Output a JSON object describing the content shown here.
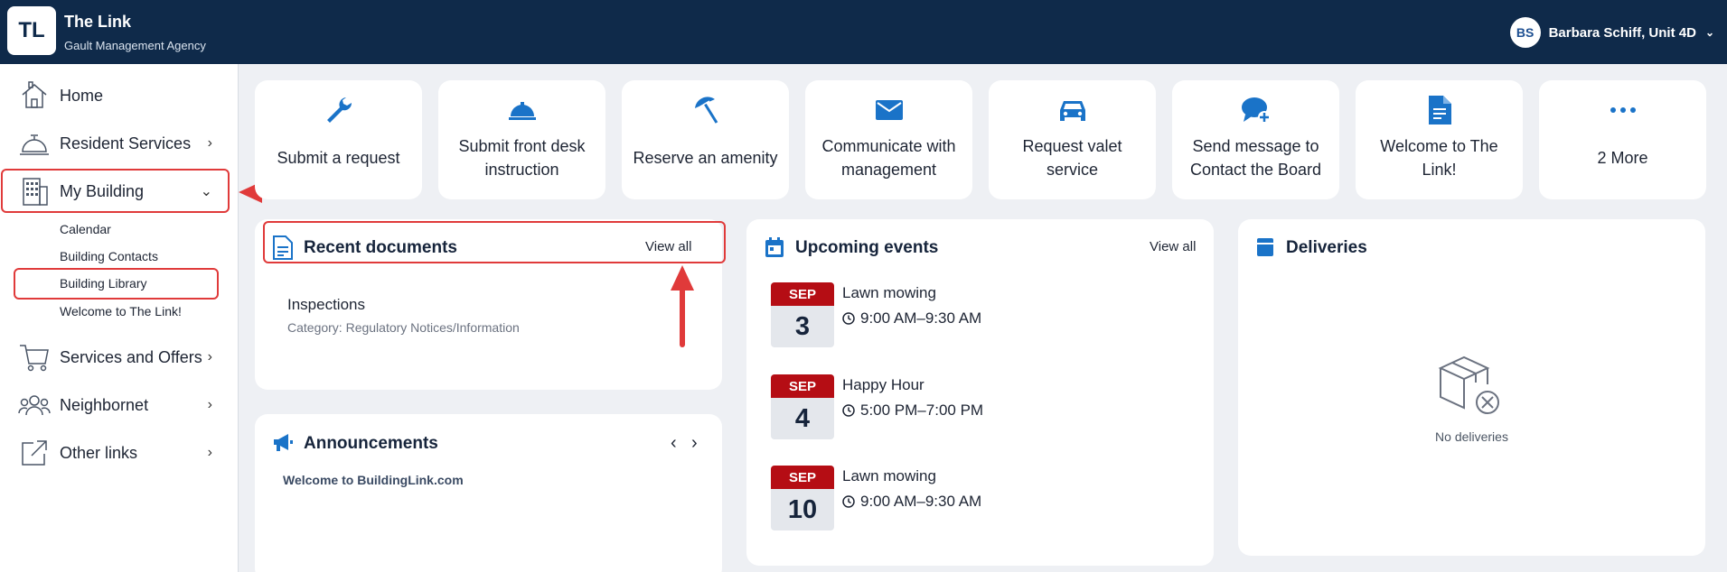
{
  "header": {
    "logo_text": "TL",
    "app_title": "The Link",
    "app_subtitle": "Gault Management Agency",
    "user_initials": "BS",
    "user_name": "Barbara Schiff, Unit 4D",
    "bg_color": "#0f2a4a"
  },
  "sidebar": {
    "items": [
      {
        "label": "Home",
        "icon": "home-icon",
        "expandable": false
      },
      {
        "label": "Resident Services",
        "icon": "service-bell-icon",
        "expandable": true
      },
      {
        "label": "My Building",
        "icon": "building-icon",
        "expandable": true,
        "expanded": true
      },
      {
        "label": "Services and Offers",
        "icon": "cart-icon",
        "expandable": true
      },
      {
        "label": "Neighbornet",
        "icon": "people-icon",
        "expandable": true
      },
      {
        "label": "Other links",
        "icon": "external-link-icon",
        "expandable": true
      }
    ],
    "subitems": [
      "Calendar",
      "Building Contacts",
      "Building Library",
      "Welcome to The Link!"
    ]
  },
  "quick_actions": [
    {
      "label": "Submit a request",
      "icon": "wrench-icon"
    },
    {
      "label": "Submit front desk instruction",
      "icon": "service-bell-icon"
    },
    {
      "label": "Reserve an amenity",
      "icon": "umbrella-icon"
    },
    {
      "label": "Communicate with management",
      "icon": "envelope-icon"
    },
    {
      "label": "Request valet service",
      "icon": "car-icon"
    },
    {
      "label": "Send message to Contact the Board",
      "icon": "chat-plus-icon"
    },
    {
      "label": "Welcome to The Link!",
      "icon": "document-icon"
    },
    {
      "label": "2 More",
      "icon": "more-dots-icon"
    }
  ],
  "recent_documents": {
    "title": "Recent documents",
    "view_all": "View all",
    "items": [
      {
        "title": "Inspections",
        "category": "Category: Regulatory Notices/Information"
      }
    ]
  },
  "announcements": {
    "title": "Announcements",
    "items": [
      "Welcome to BuildingLink.com"
    ]
  },
  "upcoming_events": {
    "title": "Upcoming events",
    "view_all": "View all",
    "items": [
      {
        "month": "SEP",
        "day": "3",
        "title": "Lawn mowing",
        "time": "9:00 AM–9:30 AM"
      },
      {
        "month": "SEP",
        "day": "4",
        "title": "Happy Hour",
        "time": "5:00 PM–7:00 PM"
      },
      {
        "month": "SEP",
        "day": "10",
        "title": "Lawn mowing",
        "time": "9:00 AM–9:30 AM"
      }
    ]
  },
  "deliveries": {
    "title": "Deliveries",
    "empty_text": "No deliveries"
  },
  "colors": {
    "accent": "#1a73c8",
    "highlight": "#e03a3a",
    "event_month": "#b50d14"
  }
}
